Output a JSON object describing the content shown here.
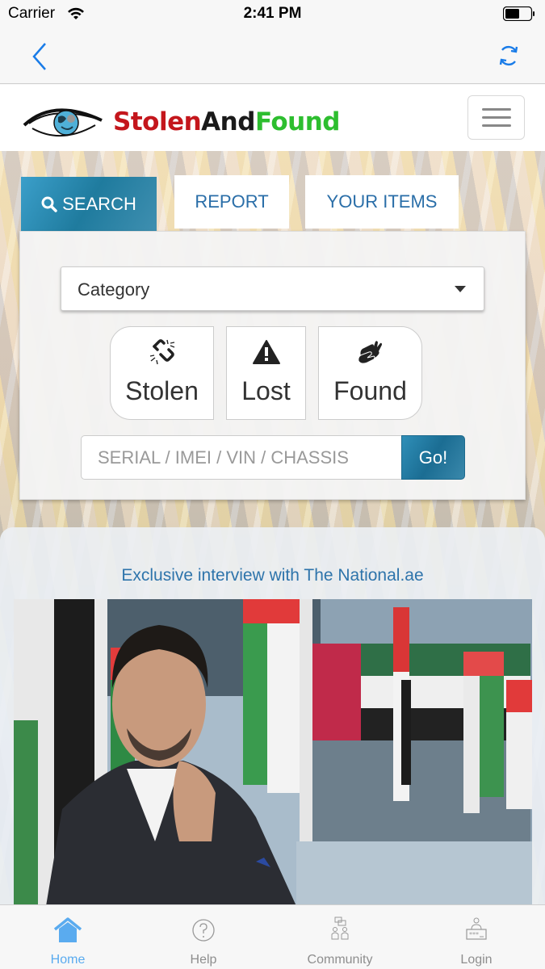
{
  "status_bar": {
    "carrier": "Carrier",
    "time": "2:41 PM",
    "icons": [
      "wifi-icon",
      "battery-icon"
    ]
  },
  "nav_bar": {
    "back_icon": "chevron-left-icon",
    "refresh_icon": "refresh-icon"
  },
  "header": {
    "logo": {
      "part1": "Stolen",
      "part2": "And",
      "part3": "Found",
      "colors": {
        "part1": "#c4161c",
        "part2": "#1a1a1a",
        "part3": "#2dbe2f"
      }
    },
    "menu_icon": "hamburger-icon"
  },
  "tabs": [
    {
      "label": "SEARCH",
      "icon": "search-icon",
      "active": true
    },
    {
      "label": "REPORT",
      "active": false
    },
    {
      "label": "YOUR ITEMS",
      "active": false
    }
  ],
  "search_panel": {
    "category_select": {
      "selected": "Category"
    },
    "type_buttons": [
      {
        "label": "Stolen",
        "icon": "broken-link-icon"
      },
      {
        "label": "Lost",
        "icon": "warning-icon"
      },
      {
        "label": "Found",
        "icon": "hands-icon"
      }
    ],
    "serial_input": {
      "value": "",
      "placeholder": "SERIAL / IMEI / VIN / CHASSIS"
    },
    "go_label": "Go!"
  },
  "news": {
    "title": "Exclusive interview with The National.ae",
    "image_alt": "man in suit in front of UAE flags"
  },
  "tab_bar": {
    "items": [
      {
        "label": "Home",
        "icon": "home-icon",
        "active": true
      },
      {
        "label": "Help",
        "icon": "help-icon",
        "active": false
      },
      {
        "label": "Community",
        "icon": "community-icon",
        "active": false
      },
      {
        "label": "Login",
        "icon": "login-icon",
        "active": false
      }
    ]
  },
  "colors": {
    "accent": "#2a6ea8",
    "tab_active": "#1f7b9e",
    "tabbar_active": "#5aabef",
    "ios_blue": "#1a7ce8"
  }
}
